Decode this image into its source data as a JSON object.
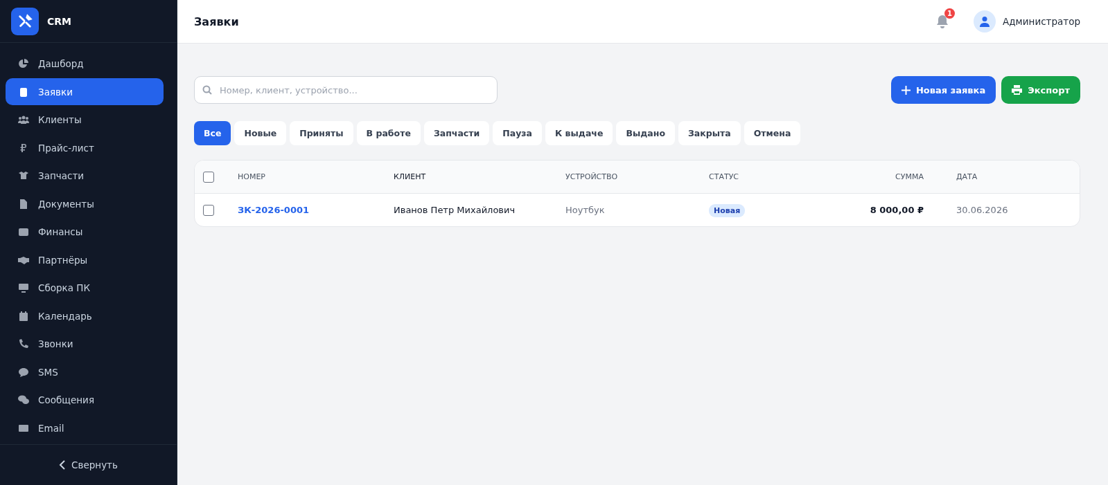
{
  "sidebar": {
    "logo": "CRM",
    "items": [
      {
        "label": "Дашборд",
        "selected": false
      },
      {
        "label": "Заявки",
        "selected": true
      },
      {
        "label": "Клиенты",
        "selected": false
      },
      {
        "label": "Прайс-лист",
        "selected": false
      },
      {
        "label": "Запчасти",
        "selected": false
      },
      {
        "label": "Документы",
        "selected": false
      },
      {
        "label": "Финансы",
        "selected": false
      },
      {
        "label": "Партнёры",
        "selected": false
      },
      {
        "label": "Сборка ПК",
        "selected": false
      },
      {
        "label": "Календарь",
        "selected": false
      },
      {
        "label": "Звонки",
        "selected": false
      },
      {
        "label": "SMS",
        "selected": false
      },
      {
        "label": "Сообщения",
        "selected": false
      },
      {
        "label": "Email",
        "selected": false
      }
    ],
    "collapse": "Свернуть"
  },
  "header": {
    "title": "Заявки",
    "notifications": "1",
    "user": "Администратор"
  },
  "search": {
    "placeholder": "Номер, клиент, устройство..."
  },
  "buttons": [
    {
      "label": "Новая заявка",
      "kind": "create"
    },
    {
      "label": "Экспорт",
      "kind": "export"
    }
  ],
  "filters": [
    {
      "label": "Все",
      "selected": true
    },
    {
      "label": "Новые",
      "selected": false
    },
    {
      "label": "Приняты",
      "selected": false
    },
    {
      "label": "В работе",
      "selected": false
    },
    {
      "label": "Запчасти",
      "selected": false
    },
    {
      "label": "Пауза",
      "selected": false
    },
    {
      "label": "К выдаче",
      "selected": false
    },
    {
      "label": "Выдано",
      "selected": false
    },
    {
      "label": "Закрыта",
      "selected": false
    },
    {
      "label": "Отмена",
      "selected": false
    }
  ],
  "table": {
    "all_checked": false,
    "columns": [
      "НОМЕР",
      "КЛИЕНТ",
      "УСТРОЙСТВО",
      "СТАТУС",
      "СУММА",
      "ДАТА"
    ],
    "rows": [
      {
        "checked": false,
        "number": "ЗК-2026-0001",
        "client": "Иванов Петр Михайлович",
        "device": "Ноутбук",
        "status": "Новая",
        "sum": "8 000,00 ₽",
        "date": "30.06.2026"
      }
    ]
  }
}
